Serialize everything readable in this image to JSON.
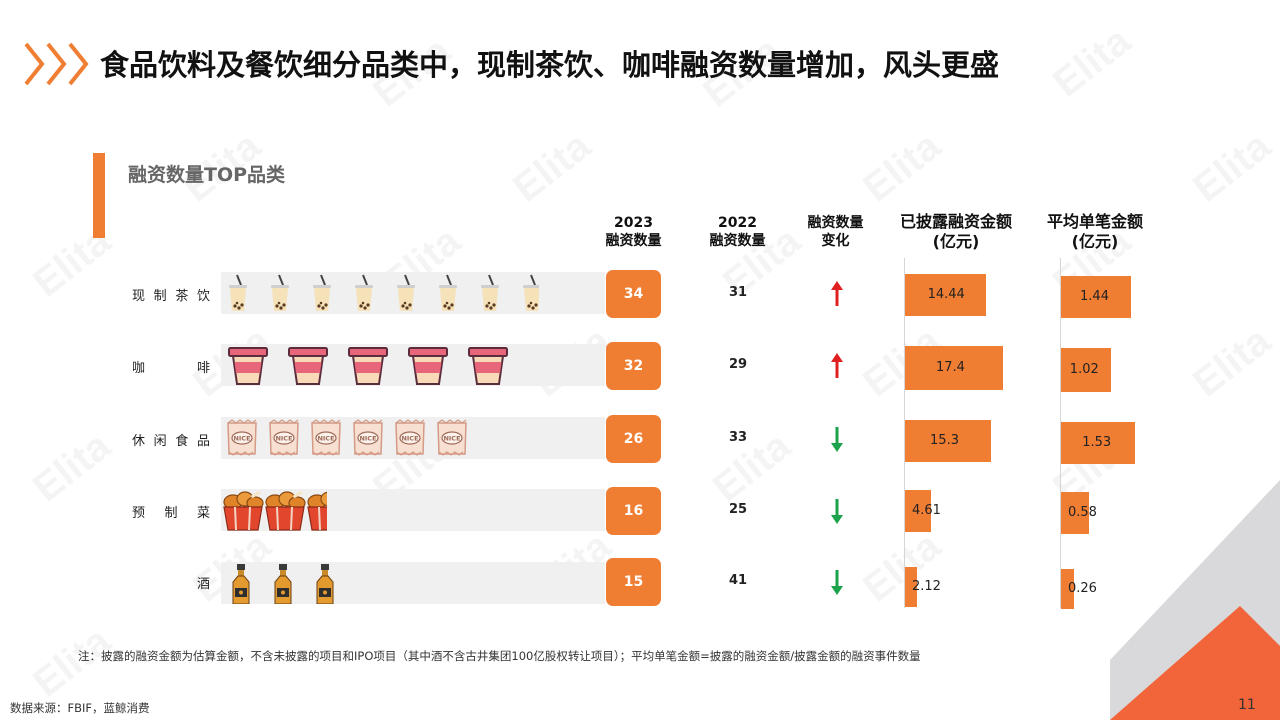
{
  "header": {
    "title": "食品饮料及餐饮细分品类中，现制茶饮、咖啡融资数量增加，风头更盛",
    "accent_color": "#ef7d32"
  },
  "section": {
    "title": "融资数量TOP品类"
  },
  "columns": {
    "c2023": [
      "2023",
      "融资数量"
    ],
    "c2022": [
      "2022",
      "融资数量"
    ],
    "change": [
      "融资数量",
      "变化"
    ],
    "amount": [
      "已披露融资金额",
      "(亿元)"
    ],
    "avg": [
      "平均单笔金额",
      "(亿元)"
    ]
  },
  "chart_data": {
    "type": "table",
    "categories": [
      "现制茶饮",
      "咖啡",
      "休闲食品",
      "预制菜",
      "酒"
    ],
    "category_labels": [
      [
        "现",
        "制",
        "茶",
        "饮"
      ],
      [
        "咖",
        "啡"
      ],
      [
        "休",
        "闲",
        "食",
        "品"
      ],
      [
        "预",
        "制",
        "菜"
      ],
      [
        "酒"
      ]
    ],
    "pictogram_icons": [
      "bubble-tea-icon",
      "coffee-cup-icon",
      "snack-bag-icon",
      "fried-chicken-bucket-icon",
      "liquor-bottle-icon"
    ],
    "pictogram_icon_counts": [
      7.8,
      5,
      6,
      2.5,
      3
    ],
    "financing_count_2023": [
      34,
      32,
      26,
      16,
      15
    ],
    "financing_count_2022": [
      31,
      29,
      33,
      25,
      41
    ],
    "change_direction": [
      "up",
      "up",
      "down",
      "down",
      "down"
    ],
    "disclosed_amount": [
      14.44,
      17.4,
      15.3,
      4.61,
      2.12
    ],
    "disclosed_amount_labels": [
      "14.44",
      "17.4",
      "15.3",
      "4.61",
      "2.12"
    ],
    "avg_amount": [
      1.44,
      1.02,
      1.53,
      0.58,
      0.26
    ],
    "avg_amount_labels": [
      "1.44",
      "1.02",
      "1.53",
      "0.58",
      "0.26"
    ],
    "amount_xlim": [
      0,
      24
    ],
    "avg_xlim": [
      0,
      1.85
    ],
    "colors": {
      "bar": "#ef7d32",
      "badge": "#ef7d32",
      "up": "#e02020",
      "down": "#1aa34a"
    }
  },
  "footer": {
    "note": "注：披露的融资金额为估算金额，不含未披露的项目和IPO项目（其中酒不含古井集团100亿股权转让项目）；平均单笔金额=披露的融资金额/披露金额的融资事件数量",
    "source": "数据来源：FBIF，蓝鲸消费",
    "page": "11"
  },
  "watermark": "Elita"
}
